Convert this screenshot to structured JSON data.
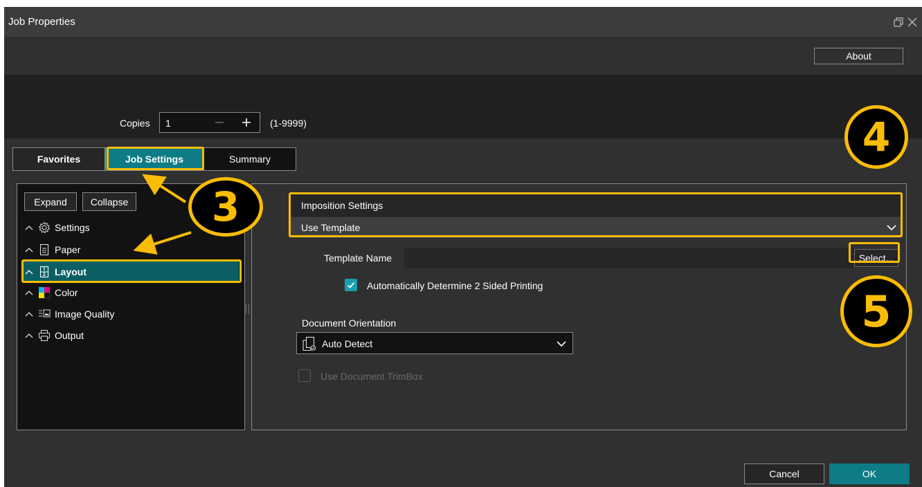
{
  "window": {
    "title": "Job Properties"
  },
  "header": {
    "about_label": "About"
  },
  "copies": {
    "label": "Copies",
    "value": "1",
    "range": "(1-9999)"
  },
  "tabs": [
    {
      "label": "Favorites"
    },
    {
      "label": "Job Settings",
      "active": true
    },
    {
      "label": "Summary"
    }
  ],
  "tree": {
    "expand_label": "Expand",
    "collapse_label": "Collapse",
    "items": [
      {
        "label": "Settings",
        "icon": "gear-icon"
      },
      {
        "label": "Paper",
        "icon": "paper-icon"
      },
      {
        "label": "Layout",
        "icon": "layout-icon",
        "selected": true
      },
      {
        "label": "Color",
        "icon": "color-icon"
      },
      {
        "label": "Image Quality",
        "icon": "image-quality-icon"
      },
      {
        "label": "Output",
        "icon": "printer-icon"
      }
    ]
  },
  "imposition": {
    "label": "Imposition Settings",
    "value": "Use Template",
    "template_name_label": "Template Name",
    "template_name_value": "",
    "select_label": "Select...",
    "auto_2sided_label": "Automatically Determine 2 Sided Printing",
    "auto_2sided_checked": true
  },
  "orientation": {
    "label": "Document Orientation",
    "value": "Auto Detect",
    "trimbox_label": "Use Document TrimBox",
    "trimbox_checked": false
  },
  "footer": {
    "cancel_label": "Cancel",
    "ok_label": "OK"
  },
  "annotations": {
    "step3": "3",
    "step4": "4",
    "step5": "5"
  },
  "colors": {
    "accent": "#0e7c86",
    "highlight": "#fbbc05",
    "selected_row": "#0b5f63"
  }
}
